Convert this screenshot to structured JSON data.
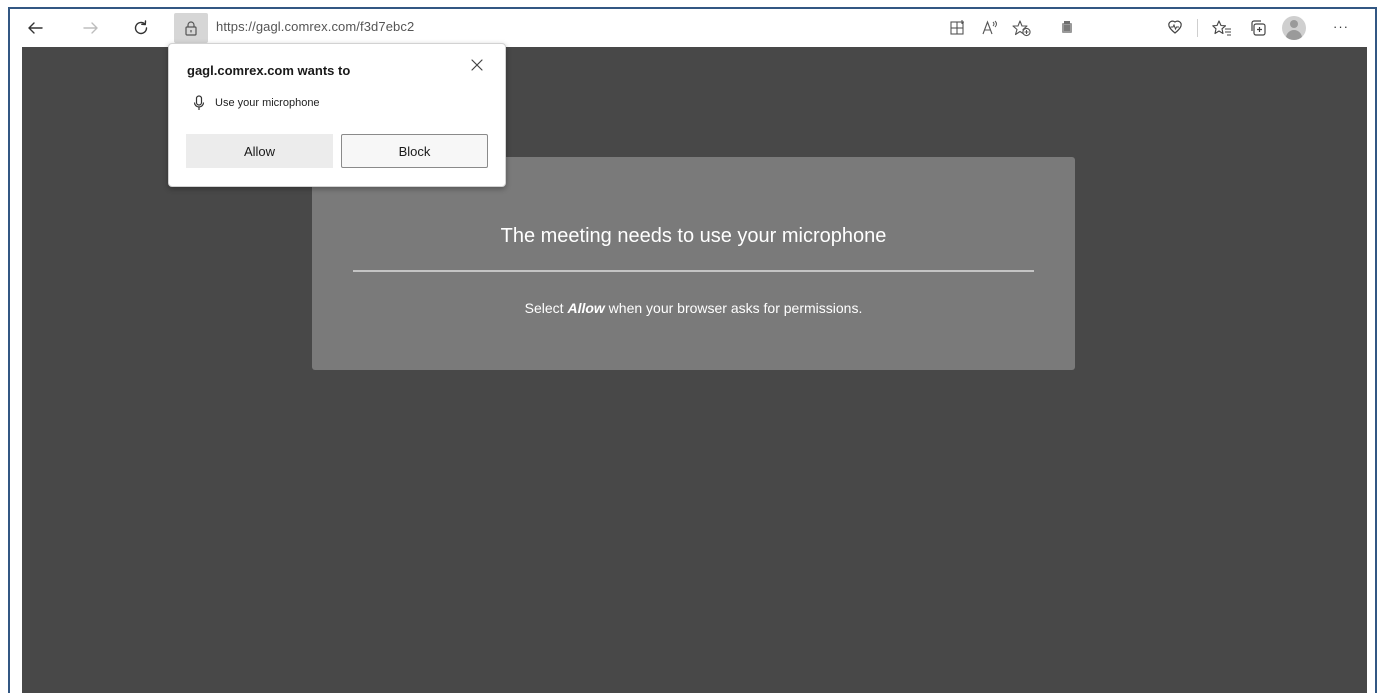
{
  "browser": {
    "url": "https://gagl.comrex.com/f3d7ebc2",
    "more_label": "···",
    "icons": {
      "back": "arrow-left-icon",
      "forward": "arrow-right-icon",
      "refresh": "refresh-icon",
      "lock": "lock-icon",
      "immersive_reader": "immersive-reader-icon",
      "read_aloud": "read-aloud-icon",
      "add_favorite": "star-add-icon",
      "extension": "extension-icon",
      "browser_essentials": "heart-pulse-icon",
      "favorites": "favorites-list-icon",
      "collections": "collections-icon",
      "profile": "profile-avatar-icon"
    }
  },
  "permission_popup": {
    "title": "gagl.comrex.com wants to",
    "permission_text": "Use your microphone",
    "allow_label": "Allow",
    "block_label": "Block"
  },
  "page": {
    "title": "The meeting needs to use your microphone",
    "instruction_prefix": "Select ",
    "instruction_emphasis": "Allow",
    "instruction_suffix": " when your browser asks for permissions."
  },
  "colors": {
    "page_background": "#484848",
    "card_background": "#7a7a7a",
    "frame_border": "#325783"
  }
}
